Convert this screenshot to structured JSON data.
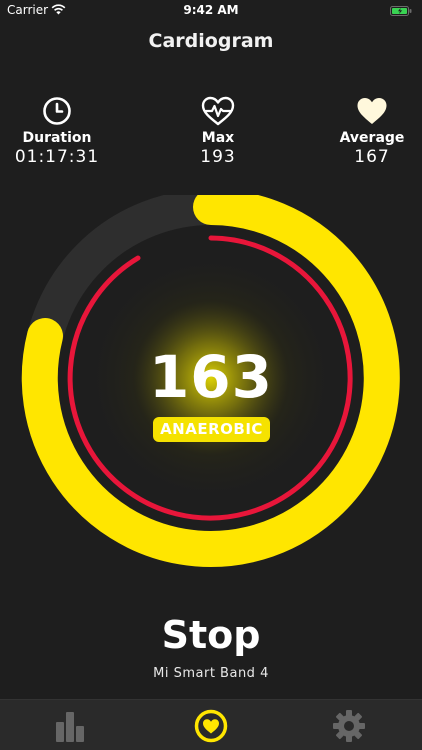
{
  "status_bar": {
    "carrier": "Carrier",
    "time": "9:42 AM",
    "wifi_icon": "wifi-icon",
    "battery_icon": "battery-icon"
  },
  "title": "Cardiogram",
  "stats": {
    "duration": {
      "label": "Duration",
      "value": "01:17:31",
      "icon": "clock-icon"
    },
    "max": {
      "label": "Max",
      "value": "193",
      "icon": "heart-pulse-icon"
    },
    "average": {
      "label": "Average",
      "value": "167",
      "icon": "heart-icon"
    }
  },
  "heart_rate": {
    "bpm": "163",
    "zone": "ANAEROBIC"
  },
  "stop_label": "Stop",
  "device_name": "Mi Smart Band 4",
  "tabs": [
    {
      "name": "statistics",
      "icon": "bar-chart-icon"
    },
    {
      "name": "heart-rate",
      "icon": "heart-circle-icon",
      "active": true
    },
    {
      "name": "settings",
      "icon": "gear-icon"
    }
  ],
  "colors": {
    "background": "#1e1e1e",
    "accent_yellow": "#ffe600",
    "inner_ring_red": "#e8163a",
    "track_gray": "#2e2e2e"
  }
}
